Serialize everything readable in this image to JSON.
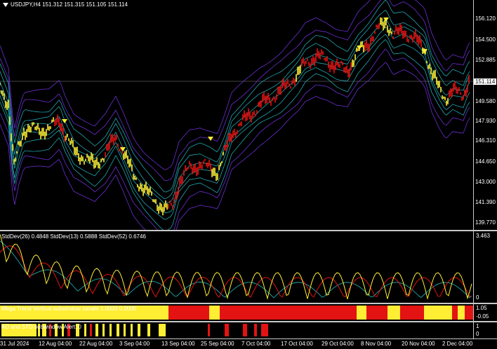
{
  "main": {
    "symbol_icon": "triangle-down-icon",
    "header": "USDJPY,H4  151.312 151.315 151.105 151.114",
    "price_levels": [
      "156.120",
      "154.500",
      "152.885",
      "151.114",
      "149.580",
      "147.930",
      "146.310",
      "144.650",
      "143.000",
      "141.390",
      "139.770"
    ],
    "current_price": "151.114"
  },
  "std_window": {
    "header": "StdDev(26) 0.4848  StdDev(13) 0.5888  StdDev(52) 0.6746",
    "scale_top": "3.463",
    "scale_bottom": "0"
  },
  "mtv_window": {
    "header": "Mega Trend Vertical subwindow zanale 1.0000 0.0000",
    "scale_top": "1.05",
    "scale_bottom": "-0.05"
  },
  "cstd_window": {
    "header": "AD and STD subwindow  Alert: 0",
    "scale_top": "1",
    "scale_bottom": "0"
  },
  "time_axis": [
    "31 Jul 2024",
    "12 Aug 04:00",
    "22 Aug 04:00",
    "3 Sep 04:00",
    "13 Sep 04:00",
    "25 Sep 04:00",
    "7 Oct 04:00",
    "17 Oct 04:00",
    "29 Oct 04:00",
    "8 Nov 04:00",
    "20 Nov 04:00",
    "2 Dec 04:00"
  ],
  "colors": {
    "bull": "#ffee33",
    "bear": "#e31313",
    "band_outer": "#6a2fd1",
    "band_inner": "#1fa7b0",
    "std26": "#e31313",
    "std13": "#ffee33",
    "std52": "#1fa7b0"
  }
}
